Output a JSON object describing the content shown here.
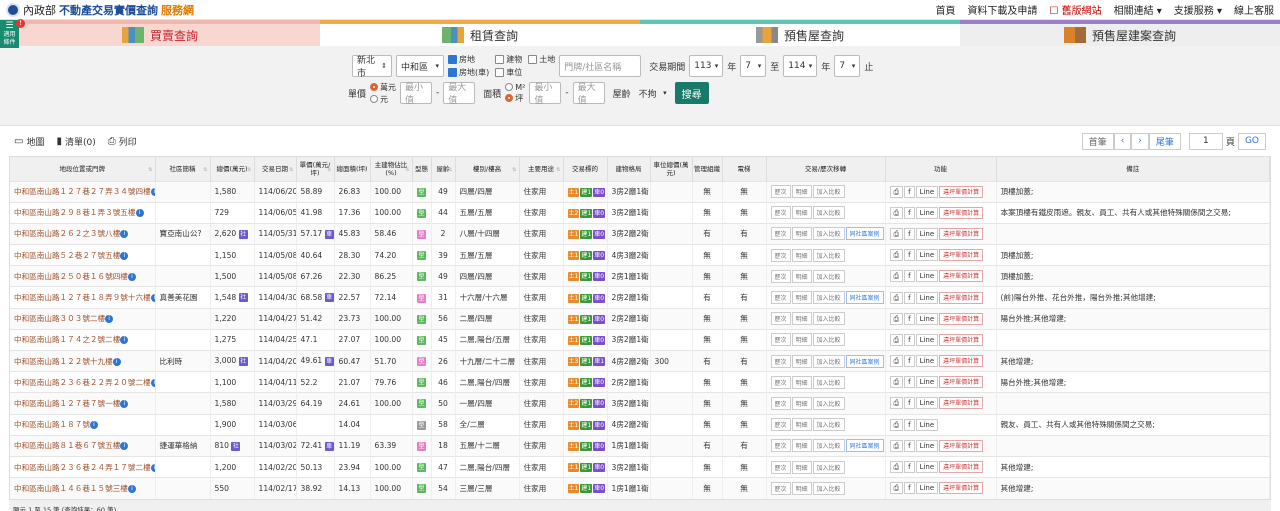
{
  "header": {
    "moi": "內政部",
    "title_a": "不動產交易實價查詢",
    "title_b": "服務網",
    "nav": [
      "首頁",
      "資料下載及申請",
      "舊版網站",
      "相關連結 ▾",
      "支援服務 ▾",
      "線上客服"
    ]
  },
  "sidebadge": {
    "line1": "適用",
    "line2": "條件",
    "count": "!"
  },
  "tabs": [
    "買賣查詢",
    "租賃查詢",
    "預售屋查詢",
    "預售屋建案查詢"
  ],
  "search": {
    "city": "新北市",
    "district": "中和區",
    "checks": [
      {
        "label": "房地",
        "on": true
      },
      {
        "label": "建物",
        "on": false
      },
      {
        "label": "土地",
        "on": false
      },
      {
        "label": "房地(車)",
        "on": true
      },
      {
        "label": "車位",
        "on": false
      }
    ],
    "keyword_placeholder": "門牌/社區名稱",
    "period_label": "交易期間",
    "from_year": "113",
    "from_month": "7",
    "to_label": "至",
    "to_year": "114",
    "to_month": "7",
    "year_label": "年",
    "end_label": "止",
    "price_label": "單價",
    "price_units": [
      {
        "label": "萬元",
        "on": true
      },
      {
        "label": "元",
        "on": false
      }
    ],
    "min_placeholder": "最小值",
    "max_placeholder": "最大值",
    "dash": "-",
    "area_label": "面積",
    "area_units": [
      {
        "label": "M²",
        "on": false
      },
      {
        "label": "坪",
        "on": true
      }
    ],
    "age_label": "屋齡",
    "age_value": "不拘",
    "search_btn": "搜尋"
  },
  "toolbar": {
    "map": "地圖",
    "list": "清單(0)",
    "print": "列印",
    "pager": {
      "first": "首筆",
      "prev": "‹",
      "next": "›",
      "last": "尾筆",
      "page": "1",
      "page_unit": "頁",
      "go": "GO"
    }
  },
  "columns": [
    "地段位置或門牌",
    "社區簡稱",
    "總價(萬元)",
    "交易日期",
    "單價(萬元/坪)",
    "總面積(坪)",
    "主建物佔比(%)",
    "型態",
    "屋齡",
    "樓別/樓高",
    "主要用途",
    "交易標的",
    "建物格局",
    "車位總價(萬元)",
    "管理組織",
    "電梯",
    "交易/歷次移轉",
    "功能",
    "備註"
  ],
  "rowbtn": {
    "history": "歷次",
    "detail": "明細",
    "compare": "加入比較",
    "same": "同社區案例",
    "print": "⎙",
    "fb": "f",
    "line": "Line",
    "calc": "違坪單價計算"
  },
  "rows": [
    {
      "addr": "中和區南山路１２７巷２７弄３４號四樓",
      "comm": "",
      "price": "1,580",
      "date": "114/06/20",
      "unit": "58.89",
      "area": "26.83",
      "ratio": "100.00",
      "type": "g",
      "age": "49",
      "floor": "四層/四層",
      "use": "住家用",
      "t": [
        "1",
        "1",
        "0"
      ],
      "layout": "3房2廳1衛",
      "park": "",
      "mgmt": "無",
      "elev": "無",
      "same": false,
      "calc": true,
      "note": "頂樓加蓋;"
    },
    {
      "addr": "中和區南山路２９８巷１弄３號五樓",
      "comm": "",
      "price": "729",
      "date": "114/06/05",
      "unit": "41.98",
      "area": "17.36",
      "ratio": "100.00",
      "type": "g",
      "age": "44",
      "floor": "五層/五層",
      "use": "住家用",
      "t": [
        "2",
        "1",
        "0"
      ],
      "layout": "3房2廳1衛",
      "park": "",
      "mgmt": "無",
      "elev": "無",
      "same": false,
      "calc": true,
      "note": "本案頂樓有鐵皮雨遮。親友、員工、共有人或其他特殊關係間之交易;"
    },
    {
      "addr": "中和區南山路２６２之３號八樓",
      "comm": "寶亞南山公?",
      "price": "2,620",
      "date": "114/05/31",
      "unit": "57.17",
      "area": "45.83",
      "ratio": "58.46",
      "type": "p",
      "age": "2",
      "floor": "八層/十四層",
      "use": "住家用",
      "t": [
        "1",
        "1",
        "0"
      ],
      "layout": "3房2廳2衛",
      "park": "",
      "mgmt": "有",
      "elev": "有",
      "same": true,
      "calc": true,
      "note": ""
    },
    {
      "addr": "中和區南山路５２巷２７號五樓",
      "comm": "",
      "price": "1,150",
      "date": "114/05/08",
      "unit": "40.64",
      "area": "28.30",
      "ratio": "74.20",
      "type": "g",
      "age": "39",
      "floor": "五層/五層",
      "use": "住家用",
      "t": [
        "1",
        "1",
        "0"
      ],
      "layout": "4房3廳2衛",
      "park": "",
      "mgmt": "無",
      "elev": "無",
      "same": false,
      "calc": true,
      "note": "頂樓加蓋;"
    },
    {
      "addr": "中和區南山路２５０巷１６號四樓",
      "comm": "",
      "price": "1,500",
      "date": "114/05/08",
      "unit": "67.26",
      "area": "22.30",
      "ratio": "86.25",
      "type": "g",
      "age": "49",
      "floor": "四層/四層",
      "use": "住家用",
      "t": [
        "1",
        "1",
        "0"
      ],
      "layout": "2房1廳1衛",
      "park": "",
      "mgmt": "無",
      "elev": "無",
      "same": false,
      "calc": true,
      "note": "頂樓加蓋;"
    },
    {
      "addr": "中和區南山路１２７巷１８弄９號十六樓",
      "comm": "真善美花園",
      "price": "1,548",
      "date": "114/04/30",
      "unit": "68.58",
      "area": "22.57",
      "ratio": "72.14",
      "type": "p",
      "age": "31",
      "floor": "十六層/十六層",
      "use": "住家用",
      "t": [
        "1",
        "1",
        "0"
      ],
      "layout": "2房2廳1衛",
      "park": "",
      "mgmt": "有",
      "elev": "有",
      "same": true,
      "calc": true,
      "note": "(前)陽台外推、花台外推，陽台外推;其他增建;"
    },
    {
      "addr": "中和區南山路３０３號二樓",
      "comm": "",
      "price": "1,220",
      "date": "114/04/27",
      "unit": "51.42",
      "area": "23.73",
      "ratio": "100.00",
      "type": "g",
      "age": "56",
      "floor": "二層/四層",
      "use": "住家用",
      "t": [
        "1",
        "1",
        "0"
      ],
      "layout": "2房2廳1衛",
      "park": "",
      "mgmt": "無",
      "elev": "無",
      "same": false,
      "calc": true,
      "note": "陽台外推;其他增建;"
    },
    {
      "addr": "中和區南山路１７４之２號二樓",
      "comm": "",
      "price": "1,275",
      "date": "114/04/25",
      "unit": "47.1",
      "area": "27.07",
      "ratio": "100.00",
      "type": "g",
      "age": "45",
      "floor": "二層,陽台/五層",
      "use": "住家用",
      "t": [
        "1",
        "1",
        "0"
      ],
      "layout": "3房2廳1衛",
      "park": "",
      "mgmt": "無",
      "elev": "無",
      "same": false,
      "calc": true,
      "note": ""
    },
    {
      "addr": "中和區南山路１２２號十九樓",
      "comm": "比利時",
      "price": "3,000",
      "date": "114/04/20",
      "unit": "49.61",
      "area": "60.47",
      "ratio": "51.70",
      "type": "p",
      "age": "26",
      "floor": "十九層/二十二層",
      "use": "住家用",
      "t": [
        "3",
        "1",
        "1"
      ],
      "layout": "4房2廳2衛",
      "park": "300",
      "mgmt": "有",
      "elev": "有",
      "same": true,
      "calc": true,
      "note": "其他增建;"
    },
    {
      "addr": "中和區南山路２３６巷２２弄２０號二樓",
      "comm": "",
      "price": "1,100",
      "date": "114/04/11",
      "unit": "52.2",
      "area": "21.07",
      "ratio": "79.76",
      "type": "g",
      "age": "46",
      "floor": "二層,陽台/四層",
      "use": "住家用",
      "t": [
        "1",
        "1",
        "0"
      ],
      "layout": "2房2廳1衛",
      "park": "",
      "mgmt": "無",
      "elev": "無",
      "same": false,
      "calc": true,
      "note": "陽台外推;其他增建;"
    },
    {
      "addr": "中和區南山路１２７巷７號一樓",
      "comm": "",
      "price": "1,580",
      "date": "114/03/29",
      "unit": "64.19",
      "area": "24.61",
      "ratio": "100.00",
      "type": "g",
      "age": "50",
      "floor": "一層/四層",
      "use": "住家用",
      "t": [
        "2",
        "1",
        "0"
      ],
      "layout": "3房2廳1衛",
      "park": "",
      "mgmt": "無",
      "elev": "無",
      "same": false,
      "calc": true,
      "note": ""
    },
    {
      "addr": "中和區南山路１８７號",
      "comm": "",
      "price": "1,900",
      "date": "114/03/06",
      "unit": "",
      "area": "14.04",
      "ratio": "",
      "type": "gr",
      "age": "58",
      "floor": "全/二層",
      "use": "住家用",
      "t": [
        "1",
        "1",
        "0"
      ],
      "layout": "4房2廳2衛",
      "park": "",
      "mgmt": "無",
      "elev": "無",
      "same": false,
      "calc": false,
      "note": "親友、員工、共有人或其他特殊關係間之交易;"
    },
    {
      "addr": "中和區南山路８１巷６７號五樓",
      "comm": "捷運華格納",
      "price": "810",
      "date": "114/03/02",
      "unit": "72.41",
      "area": "11.19",
      "ratio": "63.39",
      "type": "p",
      "age": "18",
      "floor": "五層/十二層",
      "use": "住家用",
      "t": [
        "1",
        "1",
        "0"
      ],
      "layout": "1房1廳1衛",
      "park": "",
      "mgmt": "有",
      "elev": "有",
      "same": true,
      "calc": true,
      "note": ""
    },
    {
      "addr": "中和區南山路２３６巷２４弄１７號二樓",
      "comm": "",
      "price": "1,200",
      "date": "114/02/20",
      "unit": "50.13",
      "area": "23.94",
      "ratio": "100.00",
      "type": "g",
      "age": "47",
      "floor": "二層,陽台/四層",
      "use": "住家用",
      "t": [
        "1",
        "1",
        "0"
      ],
      "layout": "3房2廳1衛",
      "park": "",
      "mgmt": "無",
      "elev": "無",
      "same": false,
      "calc": true,
      "note": "其他增建;"
    },
    {
      "addr": "中和區南山路１４６巷１５號三樓",
      "comm": "",
      "price": "550",
      "date": "114/02/17",
      "unit": "38.92",
      "area": "14.13",
      "ratio": "100.00",
      "type": "g",
      "age": "54",
      "floor": "三層/三層",
      "use": "住家用",
      "t": [
        "1",
        "1",
        "0"
      ],
      "layout": "1房1廳1衛",
      "park": "",
      "mgmt": "無",
      "elev": "無",
      "same": false,
      "calc": true,
      "note": "其他增建;"
    }
  ],
  "footer": "顯示 1 至 15 筆 (查詢結果：60 筆)",
  "colors": {
    "accent": "#1a7a6a",
    "brand": "#1f4d99",
    "address": "#a0522d"
  }
}
